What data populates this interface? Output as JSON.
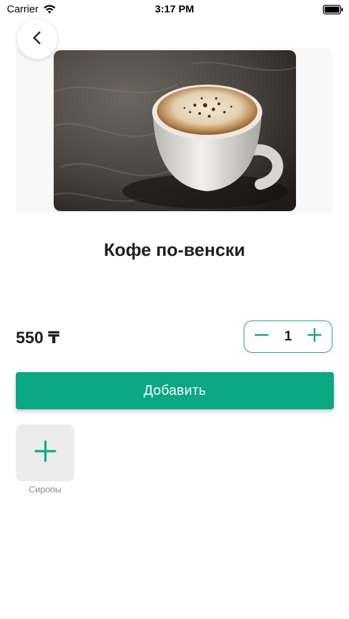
{
  "status_bar": {
    "carrier": "Carrier",
    "time": "3:17 PM",
    "wifi_icon": "wifi-icon",
    "battery_icon": "battery-icon"
  },
  "nav": {
    "back_icon": "chevron-left-icon"
  },
  "product": {
    "image_subject": "cappuccino cup",
    "title": "Кофе по-венски",
    "price": "550 ₸"
  },
  "quantity": {
    "value": "1",
    "minus_icon": "minus-icon",
    "plus_icon": "plus-icon"
  },
  "actions": {
    "add_label": "Добавить"
  },
  "modifiers": {
    "syrups_label": "Сиропы",
    "syrups_icon": "plus-icon"
  },
  "colors": {
    "accent": "#0aa883",
    "stepper_border": "#16a383",
    "tile_bg": "#ececec"
  }
}
